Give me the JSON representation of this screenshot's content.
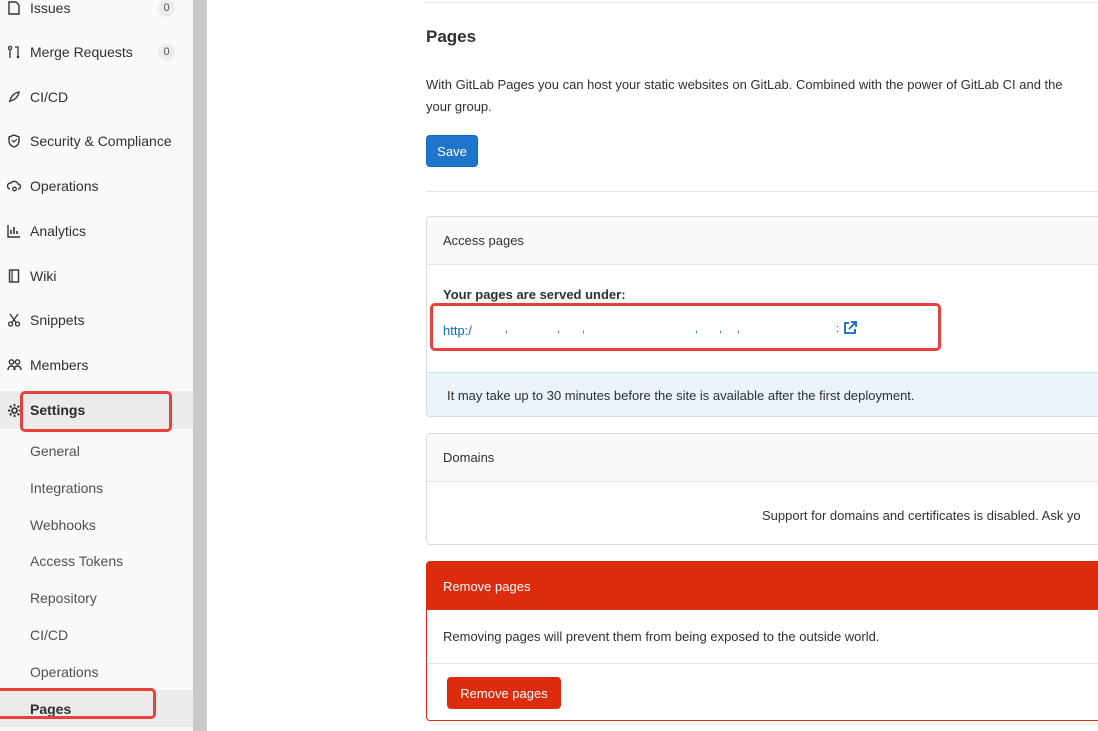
{
  "sidebar": {
    "items": [
      {
        "label": "Issues",
        "icon": "issues-icon",
        "badge": "0"
      },
      {
        "label": "Merge Requests",
        "icon": "merge-request-icon",
        "badge": "0"
      },
      {
        "label": "CI/CD",
        "icon": "rocket-icon"
      },
      {
        "label": "Security & Compliance",
        "icon": "shield-icon"
      },
      {
        "label": "Operations",
        "icon": "cloud-gear-icon"
      },
      {
        "label": "Analytics",
        "icon": "chart-icon"
      },
      {
        "label": "Wiki",
        "icon": "book-icon"
      },
      {
        "label": "Snippets",
        "icon": "scissors-icon"
      },
      {
        "label": "Members",
        "icon": "users-icon"
      },
      {
        "label": "Settings",
        "icon": "gear-icon"
      }
    ],
    "settings_sub": [
      "General",
      "Integrations",
      "Webhooks",
      "Access Tokens",
      "Repository",
      "CI/CD",
      "Operations",
      "Pages"
    ]
  },
  "main": {
    "title": "Pages",
    "intro_line1": "With GitLab Pages you can host your static websites on GitLab. Combined with the power of GitLab CI and the",
    "intro_line2": "your group.",
    "save_label": "Save",
    "access": {
      "header": "Access pages",
      "served_label": "Your pages are served under:",
      "url_prefix": "http:/",
      "info": "It may take up to 30 minutes before the site is available after the first deployment."
    },
    "domains": {
      "header": "Domains",
      "body": "Support for domains and certificates is disabled. Ask yo"
    },
    "remove": {
      "header": "Remove pages",
      "body": "Removing pages will prevent them from being exposed to the outside world.",
      "button": "Remove pages"
    }
  },
  "colors": {
    "primary": "#1f75cb",
    "danger": "#dd2b0e",
    "highlight": "#e8413c",
    "info_bg": "#e9f3fc"
  }
}
